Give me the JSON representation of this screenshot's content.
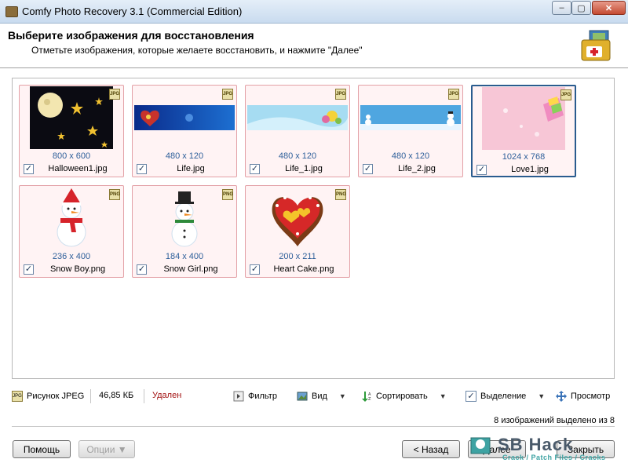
{
  "window": {
    "title": "Comfy Photo Recovery 3.1 (Commercial Edition)",
    "min_label": "–",
    "max_label": "▢",
    "close_label": "✕"
  },
  "header": {
    "title": "Выберите изображения для восстановления",
    "subtitle": "Отметьте изображения, которые желаете восстановить, и нажмите \"Далее\""
  },
  "images": [
    {
      "name": "Halloween1.jpg",
      "dims": "800 x 600",
      "format": "JPG",
      "checked": true,
      "selected": false,
      "thumb": "halloween-night"
    },
    {
      "name": "Life.jpg",
      "dims": "480 x 120",
      "format": "JPG",
      "checked": true,
      "selected": false,
      "thumb": "blue-banner-heart"
    },
    {
      "name": "Life_1.jpg",
      "dims": "480 x 120",
      "format": "JPG",
      "checked": true,
      "selected": false,
      "thumb": "light-blue-banner"
    },
    {
      "name": "Life_2.jpg",
      "dims": "480 x 120",
      "format": "JPG",
      "checked": true,
      "selected": false,
      "thumb": "snowman-banner"
    },
    {
      "name": "Love1.jpg",
      "dims": "1024 x 768",
      "format": "JPG",
      "checked": true,
      "selected": true,
      "thumb": "pink-hearts"
    },
    {
      "name": "Snow Boy.png",
      "dims": "236 x 400",
      "format": "PNG",
      "checked": true,
      "selected": false,
      "thumb": "snowman-red-hat"
    },
    {
      "name": "Snow Girl.png",
      "dims": "184 x 400",
      "format": "PNG",
      "checked": true,
      "selected": false,
      "thumb": "snowman-top-hat"
    },
    {
      "name": "Heart Cake.png",
      "dims": "200 x 211",
      "format": "PNG",
      "checked": true,
      "selected": false,
      "thumb": "heart-cake"
    }
  ],
  "status": {
    "type_label": "Рисунок JPEG",
    "size": "46,85 КБ",
    "state": "Удален",
    "filter_label": "Фильтр",
    "view_label": "Вид",
    "sort_label": "Сортировать",
    "selection_label": "Выделение",
    "preview_label": "Просмотр",
    "selected_count_text": "8 изображений выделено из 8"
  },
  "buttons": {
    "help": "Помощь",
    "options": "Опции ▼",
    "back": "< Назад",
    "next": "Далее",
    "close": "Закрыть"
  },
  "watermark": {
    "text": "SB Hack",
    "sub": "Crack / Patch Files / Cracks"
  },
  "colors": {
    "tile_border": "#e3a0a6",
    "tile_bg": "#fff3f4",
    "selected_border": "#2a5c8f",
    "dims_text": "#2e5f9a",
    "deleted_text": "#a31212"
  }
}
